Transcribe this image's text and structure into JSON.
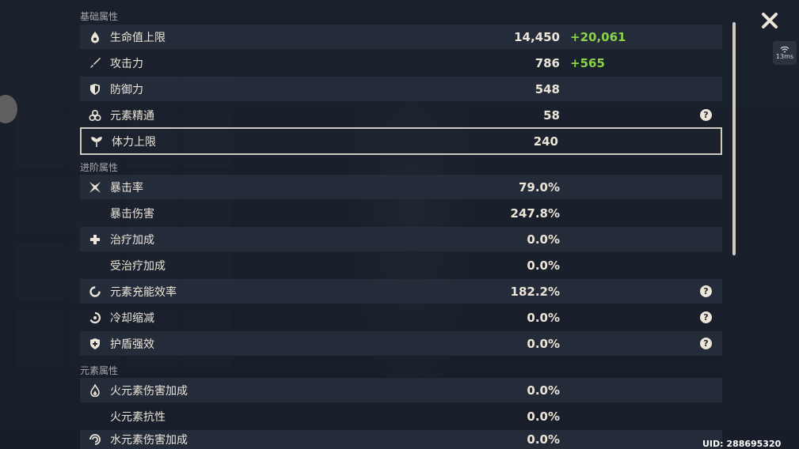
{
  "sections": {
    "basic": "基础属性",
    "advanced": "进阶属性",
    "elemental": "元素属性"
  },
  "basic_rows": [
    {
      "label": "生命值上限",
      "value": "14,450",
      "bonus": "+20,061",
      "icon": "hp-drop-icon"
    },
    {
      "label": "攻击力",
      "value": "786",
      "bonus": "+565",
      "icon": "sword-icon"
    },
    {
      "label": "防御力",
      "value": "548",
      "icon": "shield-icon"
    },
    {
      "label": "元素精通",
      "value": "58",
      "icon": "element-mastery-icon",
      "help": "?"
    },
    {
      "label": "体力上限",
      "value": "240",
      "icon": "stamina-icon"
    }
  ],
  "advanced_rows": [
    {
      "label": "暴击率",
      "value": "79.0%",
      "icon": "crit-icon"
    },
    {
      "label": "暴击伤害",
      "value": "247.8%"
    },
    {
      "label": "治疗加成",
      "value": "0.0%",
      "icon": "healing-cross-icon"
    },
    {
      "label": "受治疗加成",
      "value": "0.0%"
    },
    {
      "label": "元素充能效率",
      "value": "182.2%",
      "icon": "energy-recharge-icon",
      "help": "?"
    },
    {
      "label": "冷却缩减",
      "value": "0.0%",
      "icon": "cooldown-icon",
      "help": "?"
    },
    {
      "label": "护盾强效",
      "value": "0.0%",
      "icon": "shield-strength-icon",
      "help": "?"
    }
  ],
  "elemental_rows": [
    {
      "label": "火元素伤害加成",
      "value": "0.0%",
      "icon": "pyro-icon"
    },
    {
      "label": "火元素抗性",
      "value": "0.0%"
    },
    {
      "label": "水元素伤害加成",
      "value": "0.0%",
      "icon": "hydro-icon"
    }
  ],
  "ping": "13ms",
  "uid": "UID: 288695320",
  "colors": {
    "bonus": "#8bd24a",
    "text": "#ece5d8",
    "section": "#a8a9ab"
  }
}
